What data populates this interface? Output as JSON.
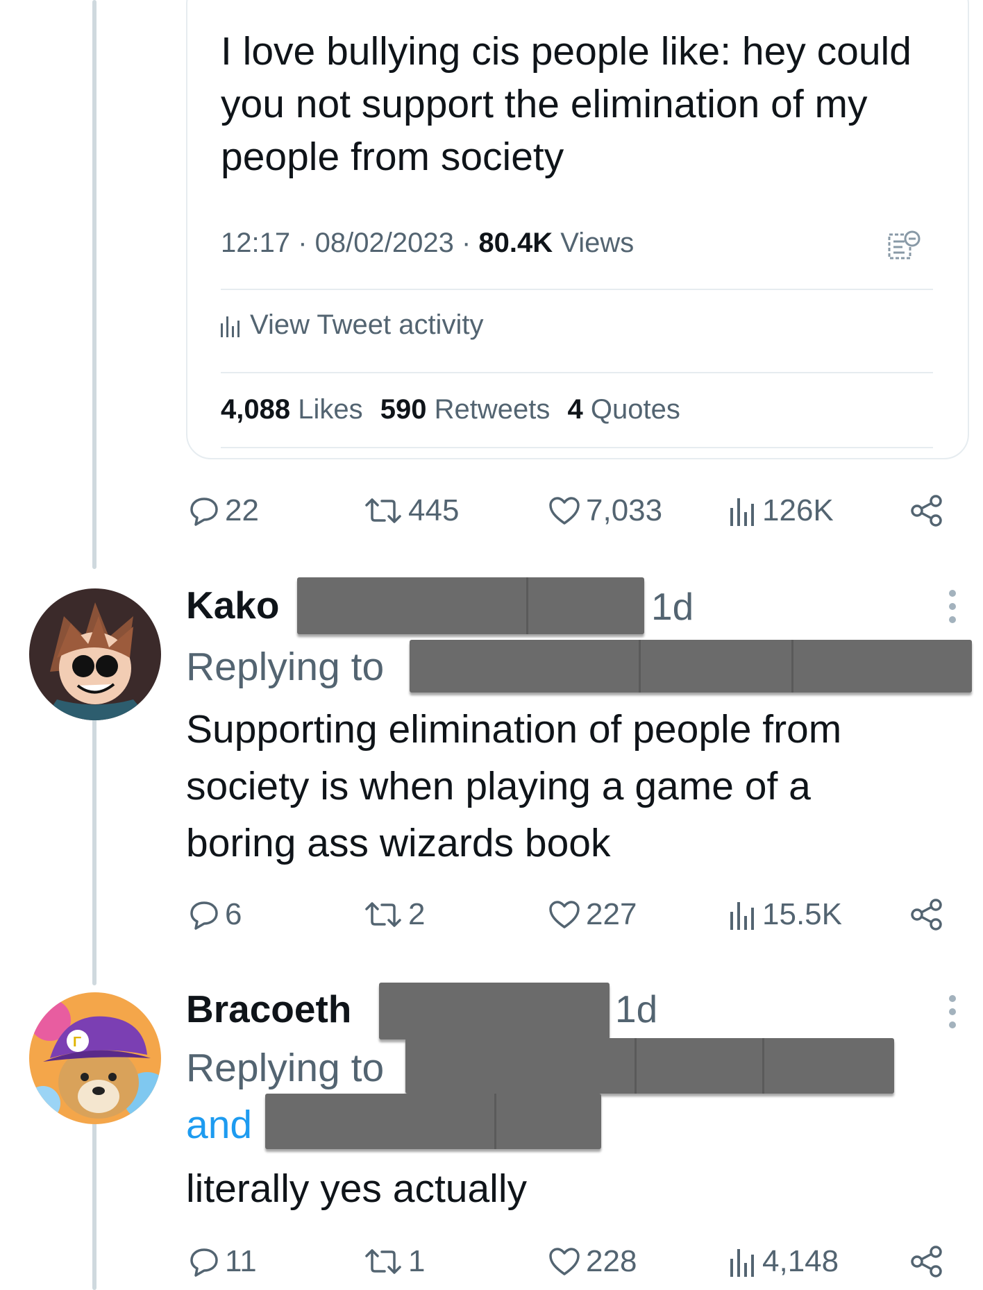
{
  "quoted_tweet": {
    "text": "I love bullying cis people like: hey could you not support the elimination of my people from society",
    "time": "12:17",
    "date": "08/02/2023",
    "views_count": "80.4K",
    "views_label": "Views",
    "activity_label": "View Tweet activity",
    "likes_count": "4,088",
    "likes_label": "Likes",
    "retweets_count": "590",
    "retweets_label": "Retweets",
    "quotes_count": "4",
    "quotes_label": "Quotes"
  },
  "main_actions": {
    "replies": "22",
    "retweets": "445",
    "likes": "7,033",
    "views": "126K"
  },
  "replies": [
    {
      "name": "Kako",
      "time": "1d",
      "replying_label": "Replying to",
      "text": "Supporting elimination of people from society is when playing a game of a boring ass wizards book",
      "actions": {
        "replies": "6",
        "retweets": "2",
        "likes": "227",
        "views": "15.5K"
      }
    },
    {
      "name": "Bracoeth",
      "time": "1d",
      "replying_label": "Replying to",
      "and_label": "and",
      "text": "literally yes actually",
      "actions": {
        "replies": "11",
        "retweets": "1",
        "likes": "228",
        "views": "4,148"
      }
    }
  ],
  "colors": {
    "text": "#0f1419",
    "secondary": "#536471",
    "link": "#1d9bf0",
    "divider": "#e6ecf0",
    "redaction": "#6b6b6b"
  }
}
